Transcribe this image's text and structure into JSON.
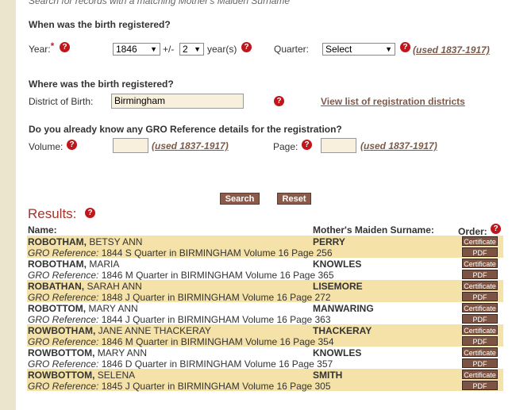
{
  "cutoff_text": "Search for records with a matching Mother's Maiden Surname",
  "when": {
    "question": "When was the birth registered?",
    "year_label": "Year:",
    "required_mark": "*",
    "year_value": "1846",
    "plus_minus": "+/-",
    "range_value": "2",
    "range_suffix": "year(s)",
    "quarter_label": "Quarter:",
    "quarter_value": "Select",
    "used_note": "(used 1837-1917)"
  },
  "where": {
    "question": "Where was the birth registered?",
    "district_label": "District of Birth:",
    "district_value": "Birmingham",
    "districts_link": "View list of registration districts"
  },
  "gro": {
    "question": "Do you already know any GRO Reference details for the registration?",
    "volume_label": "Volume:",
    "volume_note": "(used 1837-1917)",
    "page_label": "Page:",
    "page_note": "(used 1837-1917)"
  },
  "buttons": {
    "search": "Search",
    "reset": "Reset"
  },
  "help_glyph": "?",
  "results": {
    "title": "Results:",
    "col_name": "Name:",
    "col_mmn": "Mother's Maiden Surname:",
    "col_order": "Order:",
    "certificate_label": "Certificate",
    "pdf_label": "PDF",
    "gro_prefix": "GRO Reference:",
    "rows": [
      {
        "surname": "ROBOTHAM,",
        "forenames": " BETSY  ANN",
        "ref": " 1844  S Quarter in BIRMINGHAM  Volume 16  Page 256",
        "mmn": "PERRY"
      },
      {
        "surname": "ROBOTHAM,",
        "forenames": " MARIA",
        "ref": " 1846  M Quarter in BIRMINGHAM  Volume 16  Page 365",
        "mmn": "KNOWLES"
      },
      {
        "surname": "ROBATHAN,",
        "forenames": " SARAH  ANN",
        "ref": " 1848  J Quarter in BIRMINGHAM  Volume 16  Page 272",
        "mmn": "LISEMORE"
      },
      {
        "surname": "ROBOTTOM,",
        "forenames": " MARY  ANN",
        "ref": " 1844  J Quarter in BIRMINGHAM  Volume 16  Page 363",
        "mmn": "MANWARING"
      },
      {
        "surname": "ROWBOTHAM,",
        "forenames": " JANE  ANNE THACKERAY",
        "ref": " 1846  M Quarter in BIRMINGHAM  Volume 16  Page 354",
        "mmn": "THACKERAY"
      },
      {
        "surname": "ROWBOTTOM,",
        "forenames": " MARY  ANN",
        "ref": " 1846  D Quarter in BIRMINGHAM  Volume 16  Page 357",
        "mmn": "KNOWLES"
      },
      {
        "surname": "ROWBOTTOM,",
        "forenames": " SELENA",
        "ref": " 1845  J Quarter in BIRMINGHAM  Volume 16  Page 305",
        "mmn": "SMITH"
      }
    ]
  }
}
